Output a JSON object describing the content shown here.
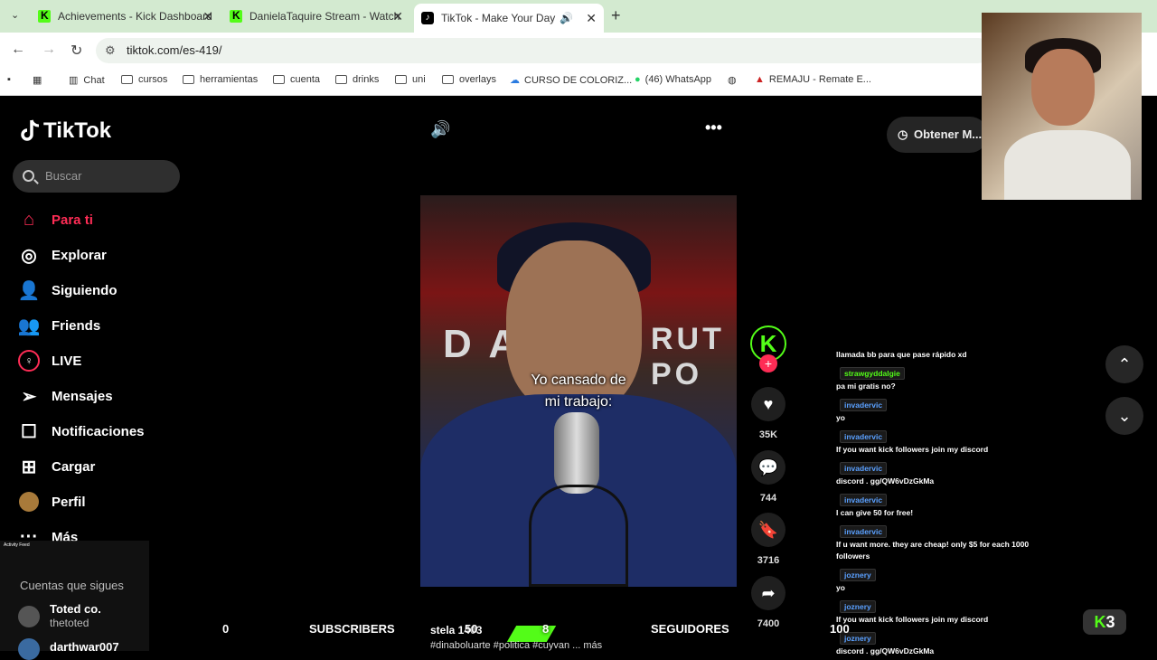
{
  "browser": {
    "tabs": [
      {
        "title": "Achievements - Kick Dashboard"
      },
      {
        "title": "DanielaTaquire Stream - Watch"
      },
      {
        "title": "TikTok - Make Your Day"
      }
    ],
    "url": "tiktok.com/es-419/",
    "bookmarks": [
      "Chat",
      "cursos",
      "herramientas",
      "cuenta",
      "drinks",
      "uni",
      "overlays",
      "CURSO DE COLORIZ...",
      "(46) WhatsApp",
      "REMAJU - Remate E..."
    ]
  },
  "tiktok": {
    "logo": "TikTok",
    "search_placeholder": "Buscar",
    "menu": [
      {
        "label": "Para ti",
        "icon": "home-icon"
      },
      {
        "label": "Explorar",
        "icon": "compass-icon"
      },
      {
        "label": "Siguiendo",
        "icon": "following-icon"
      },
      {
        "label": "Friends",
        "icon": "friends-icon"
      },
      {
        "label": "LIVE",
        "icon": "live-icon"
      },
      {
        "label": "Mensajes",
        "icon": "messages-icon"
      },
      {
        "label": "Notificaciones",
        "icon": "notifications-icon"
      },
      {
        "label": "Cargar",
        "icon": "upload-icon"
      },
      {
        "label": "Perfil",
        "icon": "profile-icon"
      },
      {
        "label": "Más",
        "icon": "more-icon"
      }
    ],
    "following_title": "Cuentas que sigues",
    "following": [
      {
        "name": "Toted co.",
        "handle": "thetoted"
      },
      {
        "name": "darthwar007"
      }
    ],
    "get_app": "Obtener M...",
    "video": {
      "caption_line1": "Yo cansado de",
      "caption_line2": "mi trabajo:",
      "author": "stela 1403",
      "hashtags": "#dinaboluarte #politica #cuyvan ... más",
      "wall_text_left": "D A D",
      "wall_text_right": "RUT PO"
    },
    "actions": {
      "likes": "35K",
      "comments": "744",
      "saves": "3716",
      "shares": "7400"
    }
  },
  "overlay": {
    "subs_count": "0",
    "subs_label": "SUBSCRIBERS",
    "subs_goal": "50",
    "followers_count": "8",
    "followers_label": "SEGUIDORES",
    "followers_goal": "100",
    "kick_badge": "3",
    "chat": [
      {
        "user": "",
        "text": "llamada bb para que pase rápido xd"
      },
      {
        "user": "strawgyddalgie",
        "text": "pa mi gratis no?"
      },
      {
        "user": "invadervic",
        "text": "yo"
      },
      {
        "user": "invadervic",
        "text": "If you want kick followers join my discord"
      },
      {
        "user": "invadervic",
        "text": "discord . gg/QW6vDzGkMa"
      },
      {
        "user": "invadervic",
        "text": "I can give 50 for free!"
      },
      {
        "user": "invadervic",
        "text": "If u want more. they are cheap! only $5 for each 1000"
      },
      {
        "user": "",
        "text": "followers"
      },
      {
        "user": "joznery",
        "text": "yo"
      },
      {
        "user": "joznery",
        "text": "If you want kick followers join my discord"
      },
      {
        "user": "joznery",
        "text": "discord . gg/QW6vDzGkMa"
      }
    ],
    "activity_title": "Activity Feed"
  }
}
